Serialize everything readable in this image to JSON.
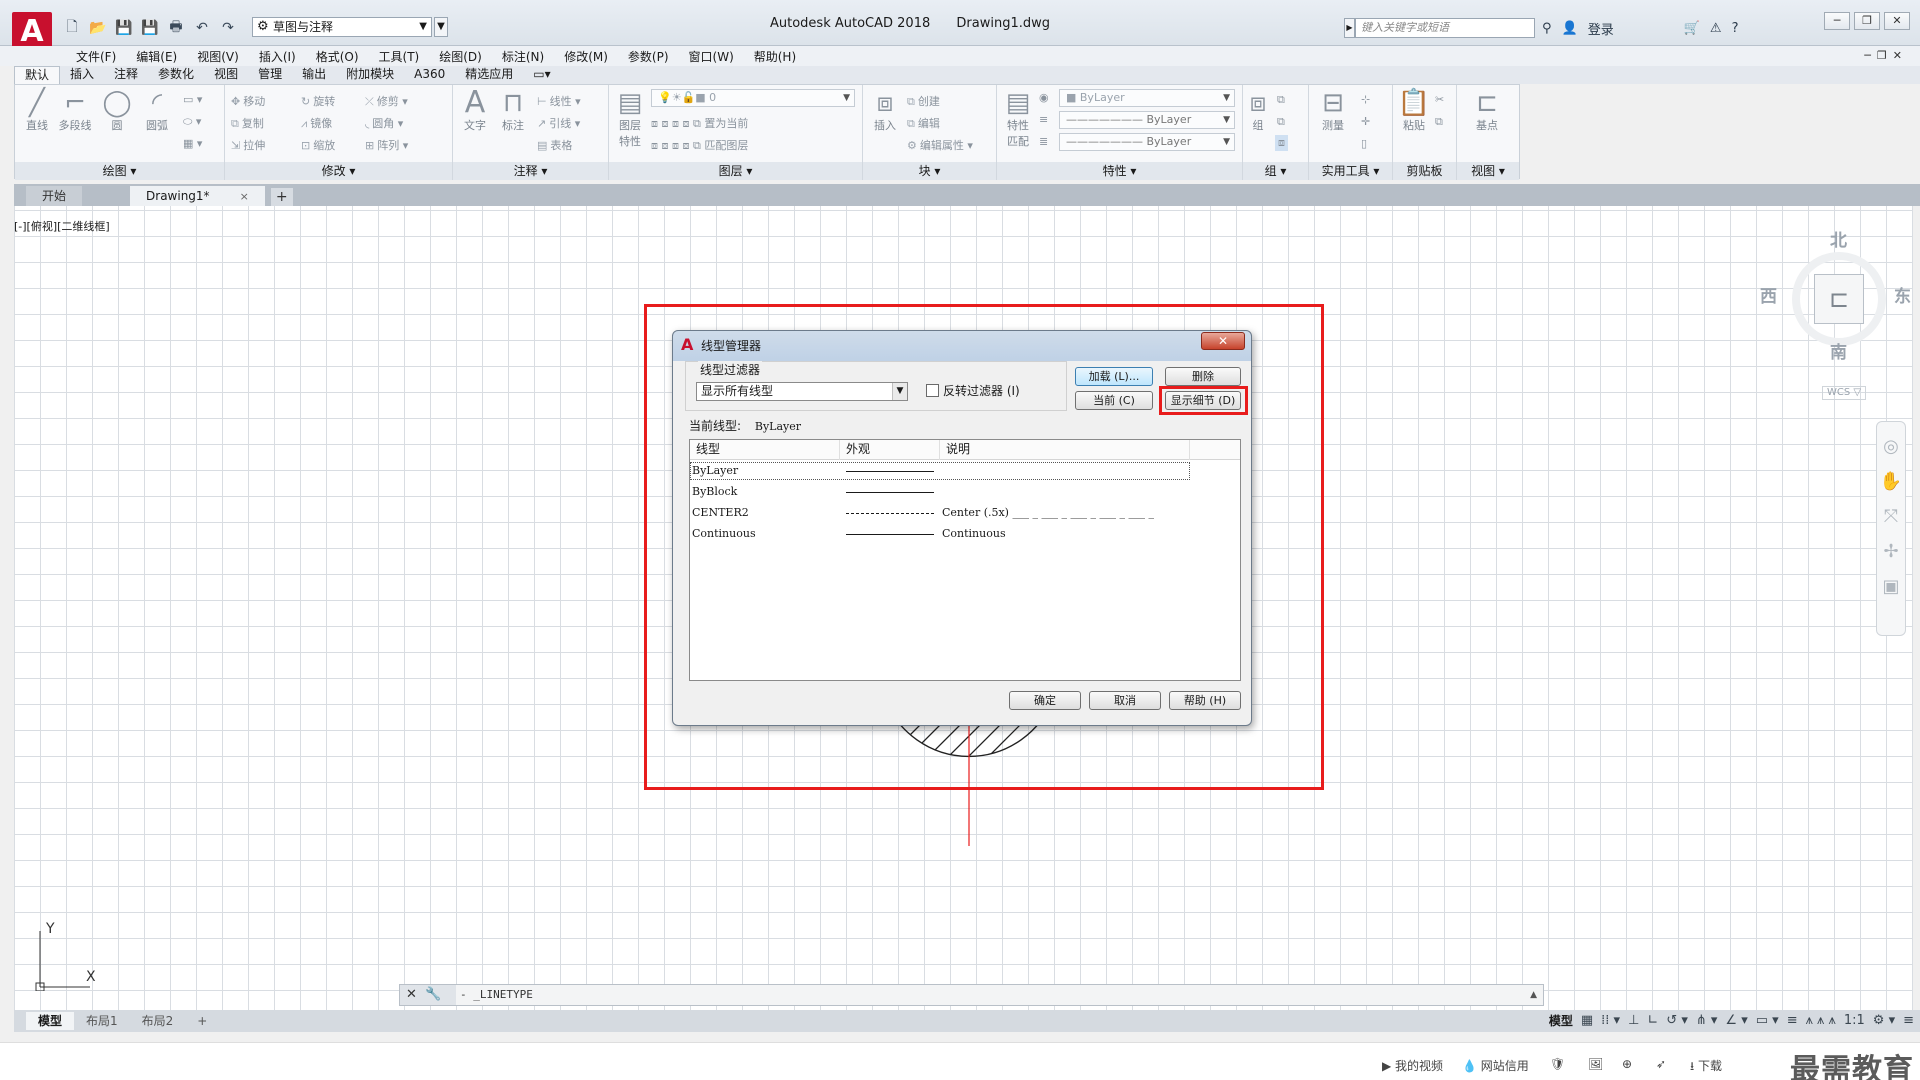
{
  "app": {
    "logo_letter": "A",
    "title": "Autodesk AutoCAD 2018",
    "document": "Drawing1.dwg",
    "workspace": "草图与注释",
    "search_placeholder": "键入关键字或短语",
    "login_label": "登录"
  },
  "menu": [
    "文件(F)",
    "编辑(E)",
    "视图(V)",
    "插入(I)",
    "格式(O)",
    "工具(T)",
    "绘图(D)",
    "标注(N)",
    "修改(M)",
    "参数(P)",
    "窗口(W)",
    "帮助(H)"
  ],
  "ribbon_tabs": [
    "默认",
    "插入",
    "注释",
    "参数化",
    "视图",
    "管理",
    "输出",
    "附加模块",
    "A360",
    "精选应用"
  ],
  "ribbon": {
    "draw": {
      "title": "绘图",
      "line": "直线",
      "polyline": "多段线",
      "circle": "圆",
      "arc": "圆弧"
    },
    "modify": {
      "title": "修改",
      "move": "移动",
      "rotate": "旋转",
      "trim": "修剪",
      "copy": "复制",
      "mirror": "镜像",
      "fillet": "圆角",
      "stretch": "拉伸",
      "scale": "缩放",
      "array": "阵列"
    },
    "annotate": {
      "title": "注释",
      "text": "文字",
      "dimension": "标注",
      "linear": "线性",
      "leader": "引线",
      "table": "表格"
    },
    "layers": {
      "title": "图层",
      "properties": "图层特性",
      "layer_value": "0",
      "set_current": "置为当前",
      "match": "匹配图层"
    },
    "block": {
      "title": "块",
      "insert": "插入",
      "create": "创建",
      "edit": "编辑",
      "edit_attr": "编辑属性"
    },
    "properties": {
      "title": "特性",
      "match": "特性匹配",
      "color": "ByLayer",
      "linetype": "ByLayer",
      "lineweight": "ByLayer"
    },
    "groups": {
      "title": "组",
      "group": "组"
    },
    "utilities": {
      "title": "实用工具",
      "measure": "测量"
    },
    "clipboard": {
      "title": "剪贴板",
      "paste": "粘贴"
    },
    "view": {
      "title": "视图",
      "base": "基点"
    }
  },
  "file_tabs": {
    "start": "开始",
    "drawing": "Drawing1*",
    "close": "×",
    "add": "+"
  },
  "canvas": {
    "view_label": "[-][俯视][二维线框]"
  },
  "viewcube": {
    "north": "北",
    "south": "南",
    "east": "东",
    "west": "西",
    "wcs": "WCS ▽"
  },
  "ucs": {
    "y": "Y",
    "x": "X"
  },
  "command_line": {
    "text": "- _LINETYPE"
  },
  "layout_tabs": [
    "模型",
    "布局1",
    "布局2"
  ],
  "status": {
    "model": "模型",
    "scale": "1:1"
  },
  "taskbar": {
    "my_video": "我的视频",
    "credit": "网站信用",
    "download": "下载",
    "watermark": "最需教育"
  },
  "dialog": {
    "title": "线型管理器",
    "filter_group": "线型过滤器",
    "filter_value": "显示所有线型",
    "invert_label": "反转过滤器 (I)",
    "load": "加载 (L)...",
    "delete": "删除",
    "current": "当前 (C)",
    "details": "显示细节 (D)",
    "current_linetype_label": "当前线型:",
    "current_linetype_value": "ByLayer",
    "columns": [
      "线型",
      "外观",
      "说明"
    ],
    "rows": [
      {
        "name": "ByLayer",
        "desc": ""
      },
      {
        "name": "ByBlock",
        "desc": ""
      },
      {
        "name": "CENTER2",
        "desc": "Center (.5x) ___ _ ___ _ ___ _ ___ _ ___ _"
      },
      {
        "name": "Continuous",
        "desc": "Continuous"
      }
    ],
    "ok": "确定",
    "cancel": "取消",
    "help": "帮助 (H)",
    "close": "✕"
  },
  "colors": {
    "highlight": "#e81c1c",
    "brand": "#c8102e"
  }
}
